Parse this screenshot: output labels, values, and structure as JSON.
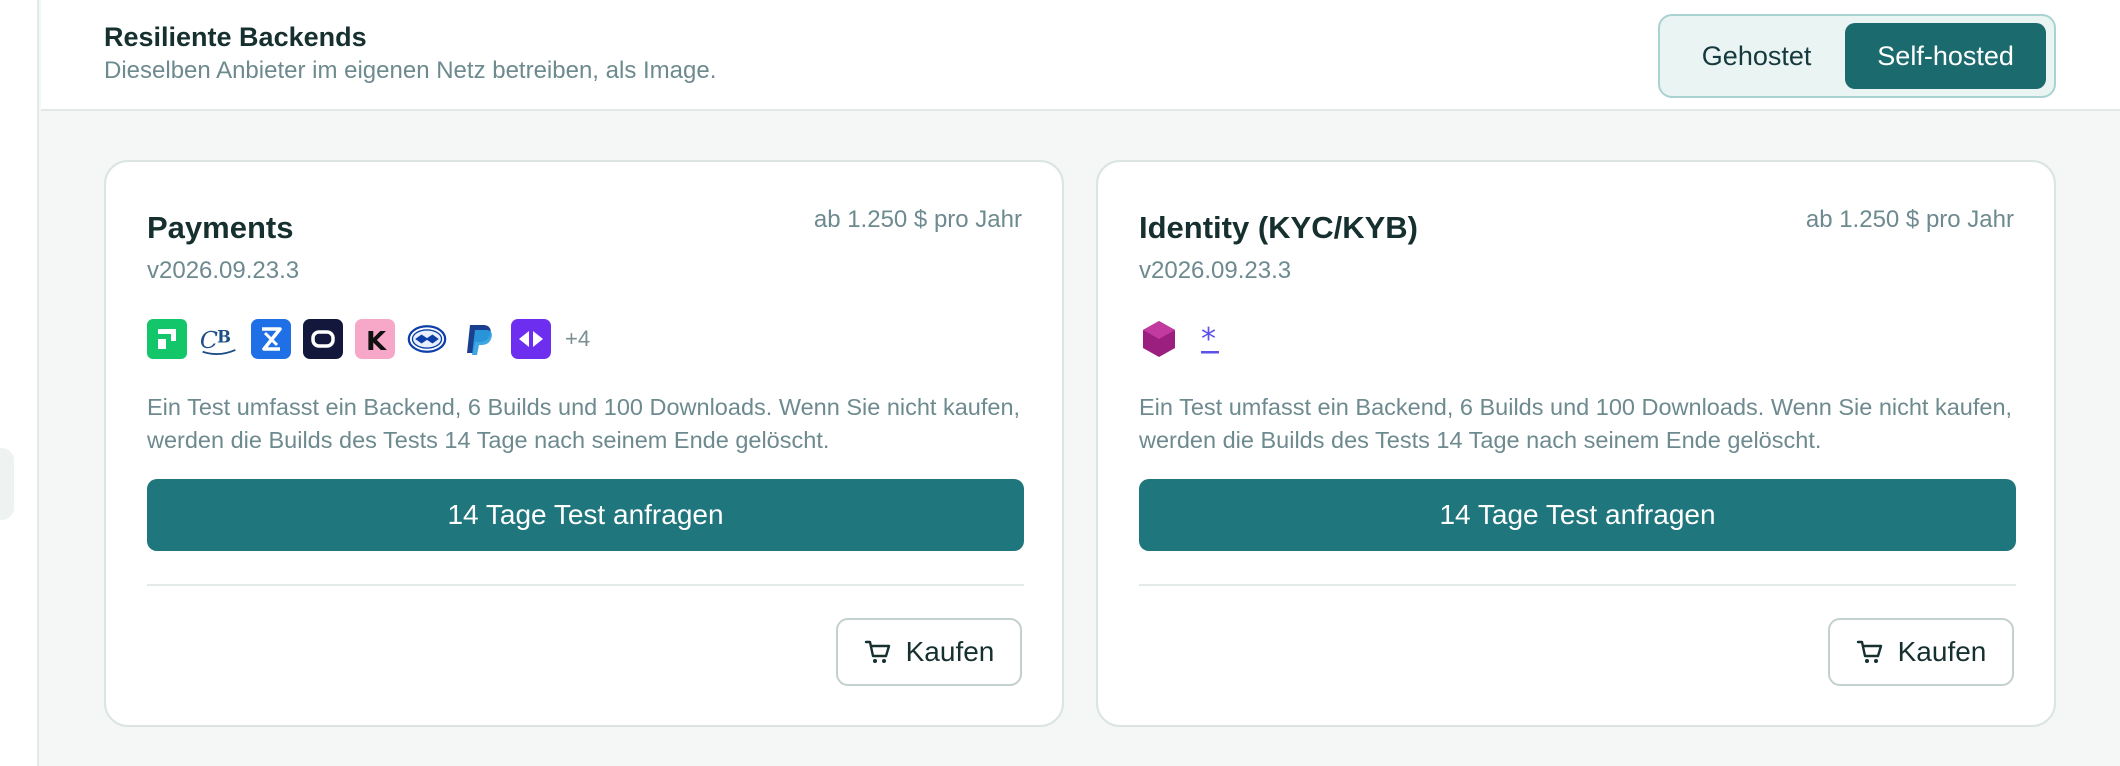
{
  "header": {
    "title": "Resiliente Backends",
    "subtitle": "Dieselben Anbieter im eigenen Netz betreiben, als Image."
  },
  "toggle": {
    "options": [
      "Gehostet",
      "Self-hosted"
    ],
    "selected": "Self-hosted"
  },
  "cards": [
    {
      "title": "Payments",
      "price": "ab 1.250 $ pro Jahr",
      "version": "v2026.09.23.3",
      "logos": [
        "green-square-logo",
        "cb-logo",
        "blue-x-logo",
        "navy-link-logo",
        "klarna-logo",
        "handshake-logo",
        "paypal-logo",
        "purple-arrows-logo"
      ],
      "more_count": "+4",
      "description": "Ein Test umfasst ein Backend, 6 Builds und 100 Downloads. Wenn Sie nicht kaufen, werden die Builds des Tests 14 Tage nach seinem Ende gelöscht.",
      "trial_label": "14 Tage Test anfragen",
      "buy_label": "Kaufen"
    },
    {
      "title": "Identity (KYC/KYB)",
      "price": "ab 1.250 $ pro Jahr",
      "version": "v2026.09.23.3",
      "logos": [
        "magenta-hexagon-logo",
        "asterisk-logo"
      ],
      "description": "Ein Test umfasst ein Backend, 6 Builds und 100 Downloads. Wenn Sie nicht kaufen, werden die Builds des Tests 14 Tage nach seinem Ende gelöscht.",
      "trial_label": "14 Tage Test anfragen",
      "buy_label": "Kaufen"
    }
  ],
  "colors": {
    "accent": "#1f767d",
    "toggle_active": "#1a6a6e",
    "muted_text": "#6d8a8f",
    "heading_text": "#16302f"
  }
}
